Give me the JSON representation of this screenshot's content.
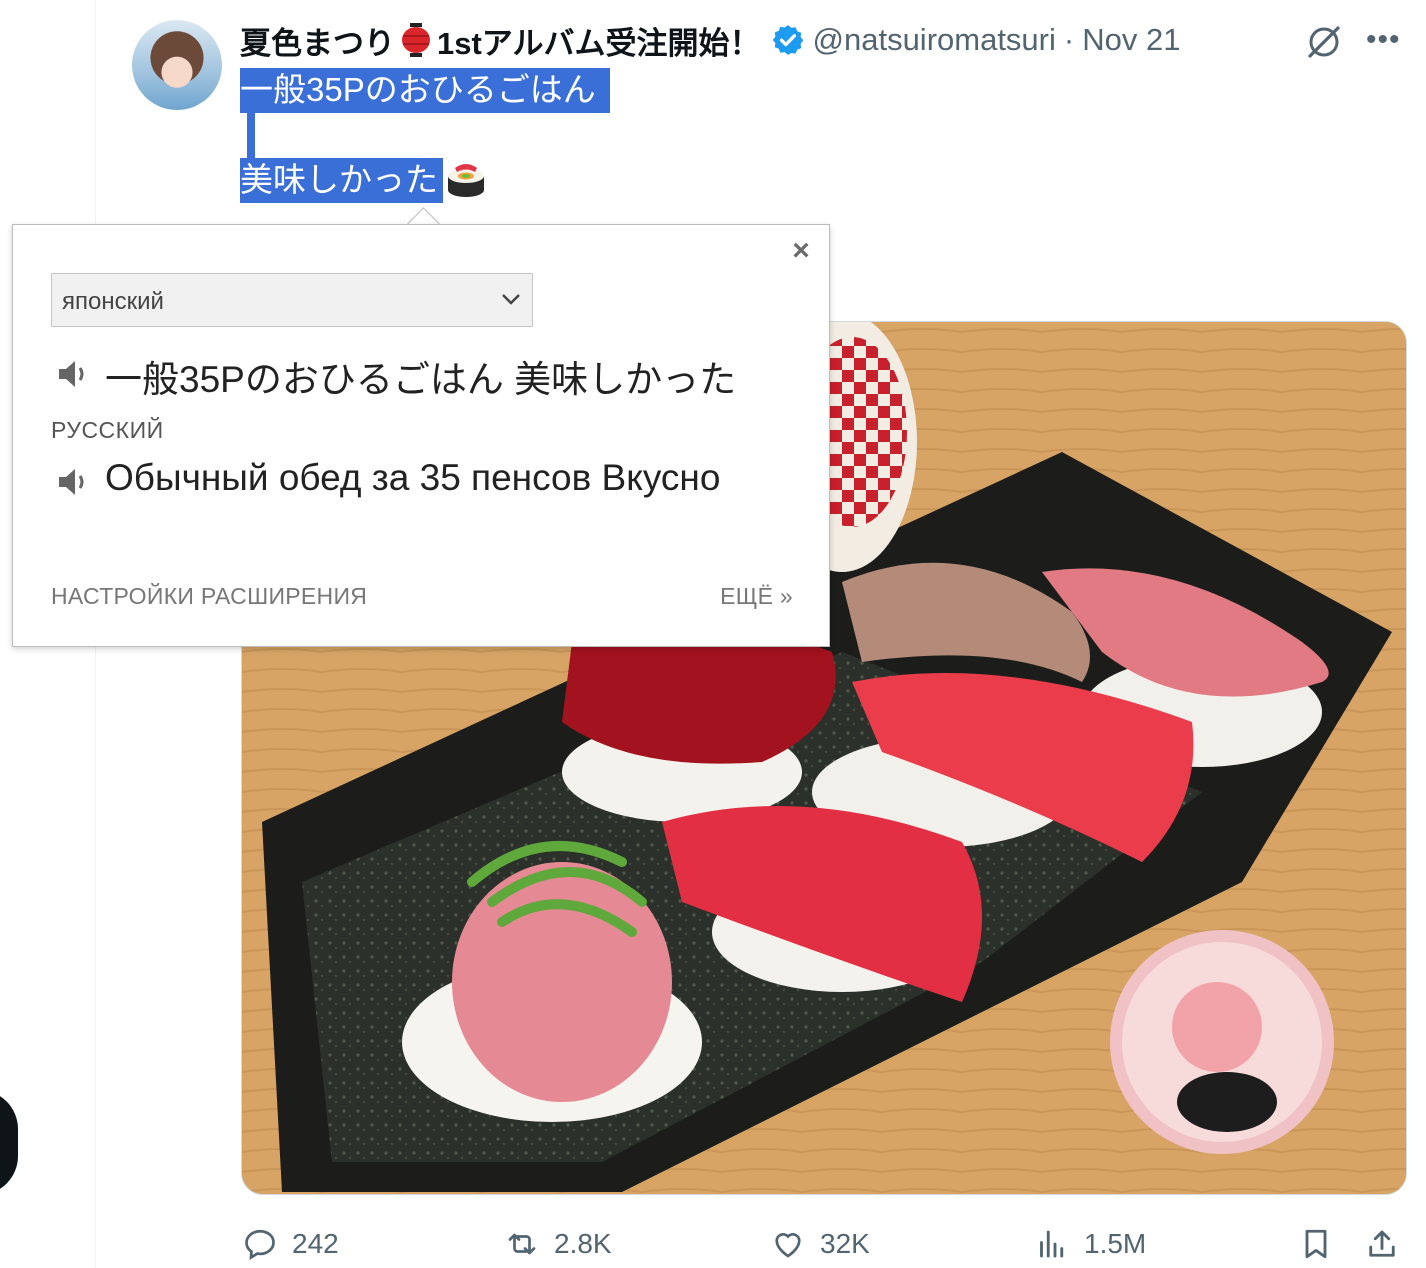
{
  "tweet": {
    "display_name": "夏色まつり",
    "display_name_suffix": "1stアルバム受注開始！",
    "handle": "@natsuiromatsuri",
    "separator": "·",
    "date": "Nov 21",
    "text_line1": "一般35Pのおひるごはん",
    "text_line2": "美味しかった",
    "emoji": "sushi-icon"
  },
  "translator": {
    "close_label": "×",
    "source_language": "японский",
    "source_text": "一般35Pのおひるごはん 美味しかった",
    "target_language": "РУССКИЙ",
    "translated_text": "Обычный обед за 35 пенсов Вкусно",
    "settings_link": "НАСТРОЙКИ РАСШИРЕНИЯ",
    "more_link": "ЕЩЁ »"
  },
  "actions": {
    "replies": "242",
    "reposts": "2.8K",
    "likes": "32K",
    "views": "1.5M"
  },
  "colors": {
    "selection": "#3b6fd8",
    "verified": "#1d9bf0",
    "muted_text": "#536471"
  }
}
